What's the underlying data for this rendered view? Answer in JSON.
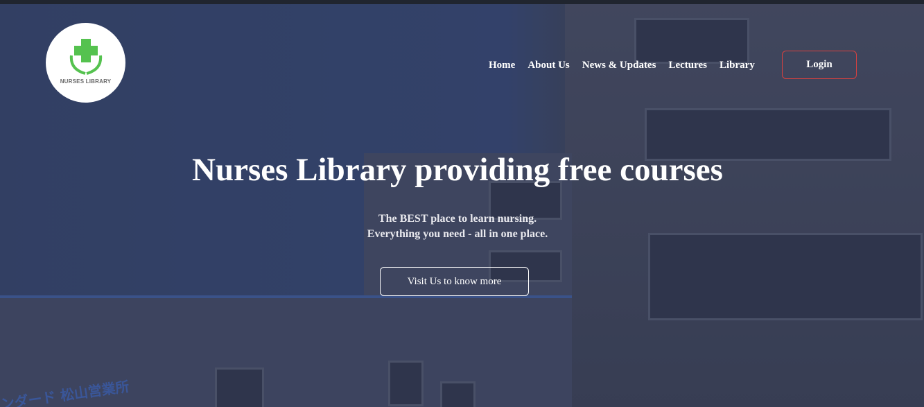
{
  "site": {
    "logo_text": "NURSES LIBRARY",
    "logo_icon": "cross-hands-icon",
    "accent_green": "#55c24f",
    "login_border": "#d9413f"
  },
  "nav": {
    "items": [
      {
        "label": "Home"
      },
      {
        "label": "About Us"
      },
      {
        "label": "News & Updates"
      },
      {
        "label": "Lectures"
      },
      {
        "label": "Library"
      }
    ],
    "login_label": "Login"
  },
  "hero": {
    "title": "Nurses Library providing free courses",
    "subtitle_line1": "The BEST place to learn nursing.",
    "subtitle_line2": "Everything you need - all in one place.",
    "cta_label": "Visit Us to know more"
  }
}
